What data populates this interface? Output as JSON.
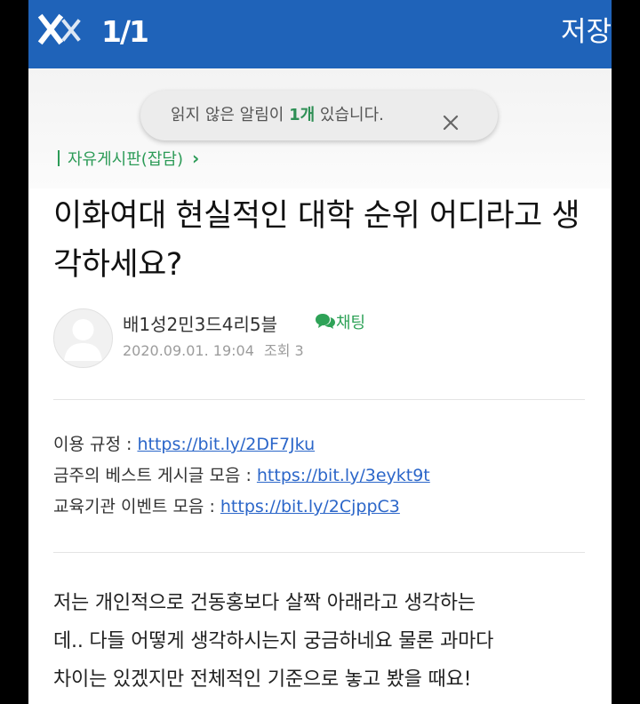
{
  "header": {
    "page_count": "1/1",
    "save_label": "저장"
  },
  "notification": {
    "text_before": "읽지 않은 알림이 ",
    "count": "1개",
    "text_after": " 있습니다."
  },
  "board": {
    "name": "자유게시판(잡담)"
  },
  "post": {
    "title": "이화여대 현실적인 대학 순위 어디라고 생각하세요?",
    "author": "배1성2민3드4리5블",
    "chat_label": "채팅",
    "date": "2020.09.01. 19:04",
    "views_label": "조회 3",
    "notices": [
      {
        "label": "이용 규정 : ",
        "url": "https://bit.ly/2DF7Jku"
      },
      {
        "label": "금주의 베스트 게시글 모음 : ",
        "url": "https://bit.ly/3eykt9t"
      },
      {
        "label": "교육기관 이벤트 모음 : ",
        "url": "https://bit.ly/2CjppC3"
      }
    ],
    "body_lines": [
      "저는 개인적으로 건동홍보다 살짝 아래라고 생각하는",
      "데.. 다들 어떻게 생각하시는지 궁금하네요 물론 과마다",
      "차이는 있겠지만 전체적인 기준으로 놓고 봤을 때요!"
    ]
  },
  "colors": {
    "header_blue": "#1f63b9",
    "accent_green": "#2c9b57",
    "link_blue": "#2b66c9"
  },
  "icons": {
    "close": "close-icon",
    "toast_close": "close-icon",
    "chevron": "chevron-right-icon",
    "chat": "chat-bubble-icon",
    "avatar": "default-user-avatar"
  }
}
